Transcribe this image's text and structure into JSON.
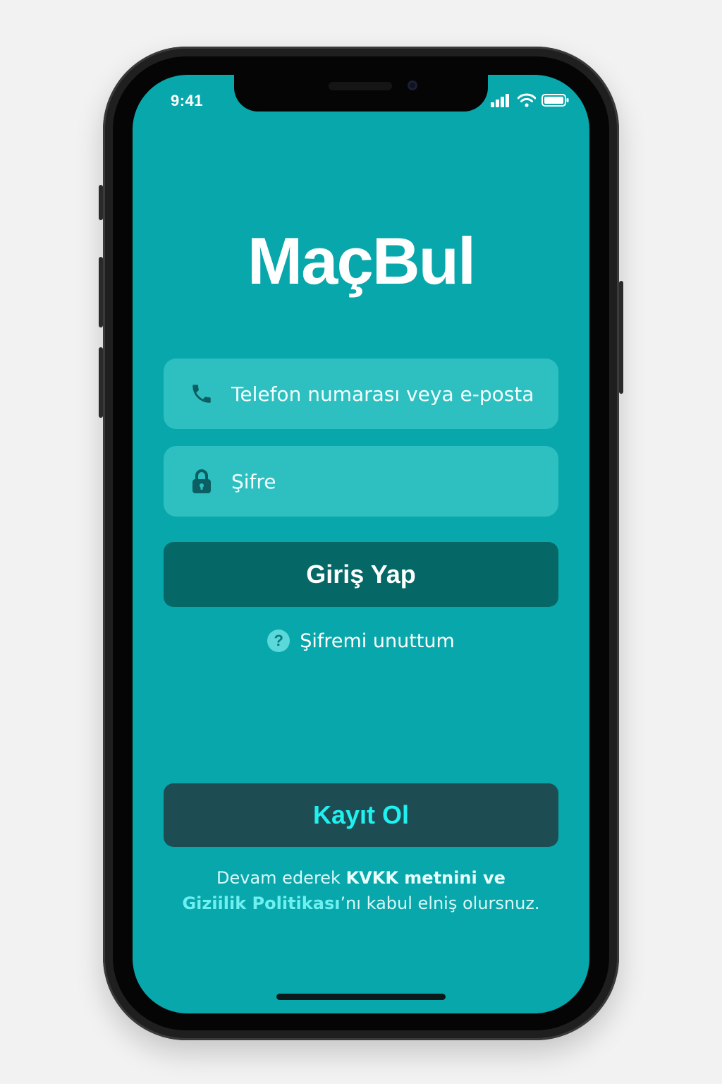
{
  "status_bar": {
    "time": "9:41",
    "icons": [
      "signal-icon",
      "wifi-icon",
      "battery-icon"
    ]
  },
  "app": {
    "title": "MaçBul"
  },
  "login_form": {
    "identifier_placeholder": "Telefon numarası veya e-posta",
    "identifier_icon": "phone-icon",
    "password_placeholder": "Şifre",
    "password_icon": "lock-icon",
    "login_button_label": "Giriş Yap",
    "forgot_password_label": "Şifremi unuttum",
    "forgot_password_icon": "question-icon"
  },
  "register": {
    "button_label": "Kayıt Ol"
  },
  "legal": {
    "prefix": "Devam ederek ",
    "kvkk_link": "KVKK metnini ve",
    "privacy_link": "Giziilik Politikası",
    "suffix": "’nı kabul elniş olursnuz."
  },
  "colors": {
    "screen_bg": "#08a7ab",
    "field_bg": "#2ebfc0",
    "login_button_bg": "#056866",
    "register_button_bg": "#1d4d53",
    "register_text": "#1ff0f0",
    "accent_link": "#6ef0f0"
  }
}
